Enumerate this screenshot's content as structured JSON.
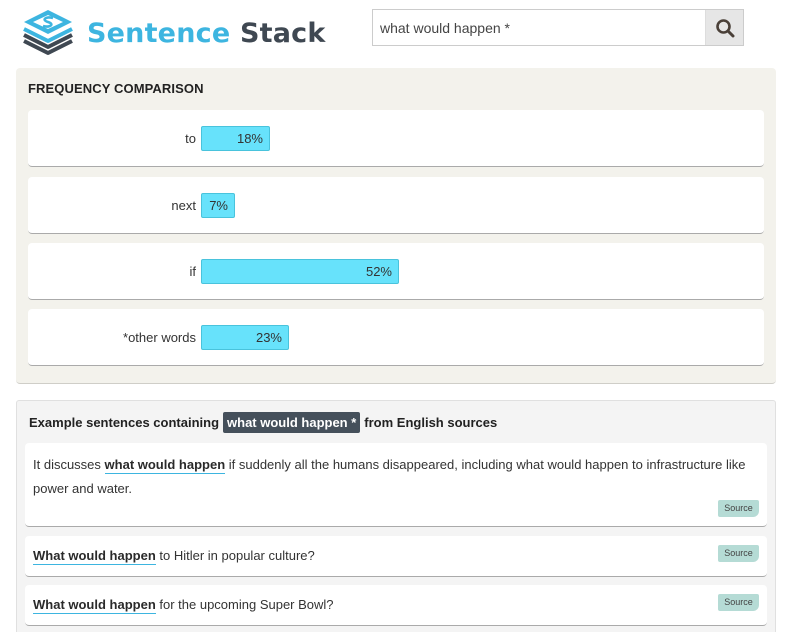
{
  "brand": {
    "word1": "Sentence",
    "word2": "Stack"
  },
  "search": {
    "value": "what would happen *",
    "placeholder": "",
    "icon": "search-icon"
  },
  "frequency": {
    "title": "FREQUENCY COMPARISON",
    "bar_color": "#67e2fb",
    "rows": [
      {
        "word": "to",
        "percent": 18,
        "label": "18%"
      },
      {
        "word": "next",
        "percent": 7,
        "label": "7%"
      },
      {
        "word": "if",
        "percent": 52,
        "label": "52%"
      },
      {
        "word": "*other words",
        "percent": 23,
        "label": "23%"
      }
    ]
  },
  "examples": {
    "heading_prefix": "Example sentences containing",
    "heading_query": "what would happen *",
    "heading_suffix": "from English sources",
    "sentences": [
      {
        "highlight": "what would happen",
        "before": "It discusses ",
        "after": " if suddenly all the humans disappeared, including what would happen to infrastructure like power and water.",
        "source_label": "Source"
      },
      {
        "highlight": "What would happen",
        "before": "",
        "after": " to Hitler in popular culture?",
        "source_label": "Source"
      },
      {
        "highlight": "What would happen",
        "before": "",
        "after": " for the upcoming Super Bowl?",
        "source_label": "Source"
      }
    ]
  }
}
